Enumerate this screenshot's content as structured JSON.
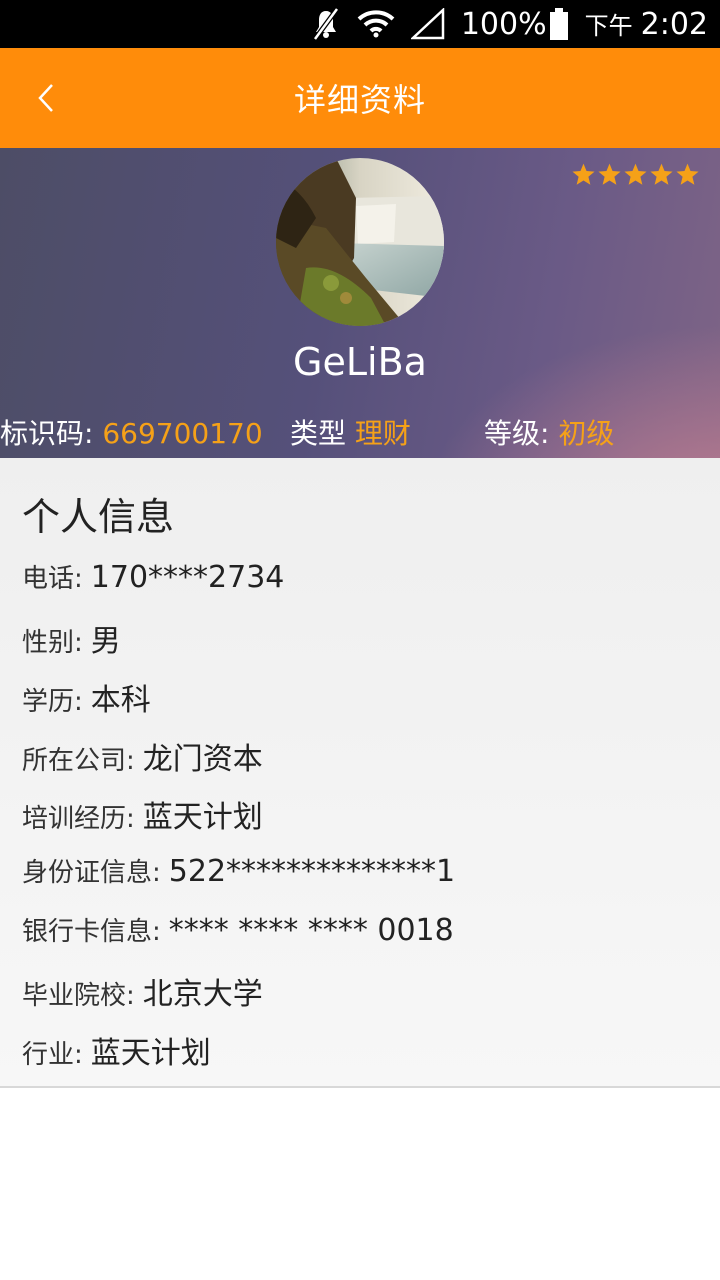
{
  "status_bar": {
    "battery": "100%",
    "ampm": "下午",
    "time": "2:02"
  },
  "app_bar": {
    "title": "详细资料"
  },
  "profile": {
    "name": "GeLiBa",
    "stars": 5,
    "star_color": "#f5a118",
    "id_label": "标识码:",
    "id_value": "669700170",
    "type_label": "类型",
    "type_value": "理财",
    "level_label": "等级:",
    "level_value": "初级"
  },
  "personal_info": {
    "title": "个人信息",
    "rows": [
      {
        "label": "电话:",
        "value": "170****2734"
      },
      {
        "label": "性别:",
        "value": "男"
      },
      {
        "label": "学历:",
        "value": "本科"
      },
      {
        "label": "所在公司:",
        "value": "龙门资本"
      },
      {
        "label": "培训经历:",
        "value": "蓝天计划"
      },
      {
        "label": "身份证信息:",
        "value": "522**************1"
      },
      {
        "label": "银行卡信息:",
        "value": "**** **** **** 0018"
      },
      {
        "label": "毕业院校:",
        "value": "北京大学"
      },
      {
        "label": "行业:",
        "value": "蓝天计划"
      }
    ]
  },
  "colors": {
    "accent": "#ff8c0a",
    "highlight": "#f5a118"
  }
}
